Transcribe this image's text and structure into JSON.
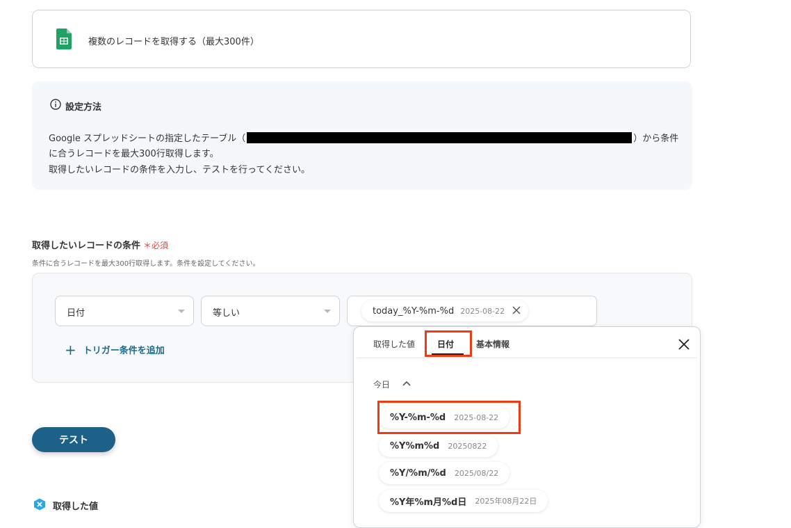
{
  "action": {
    "title": "複数のレコードを取得する（最大300件）",
    "icon": "google-sheets-icon"
  },
  "info": {
    "title": "設定方法",
    "line1_prefix": "Google スプレッドシートの指定したテーブル（",
    "line1_suffix": "）から条件",
    "line2": "に合うレコードを最大300行取得します。",
    "line3": "取得したいレコードの条件を入力し、テストを行ってください。"
  },
  "condition": {
    "label": "取得したいレコードの条件",
    "required": "＊必須",
    "description": "条件に合うレコードを最大300行取得します。条件を設定してください。",
    "field": "日付",
    "operator": "等しい",
    "value_code": "today_%Y-%m-%d",
    "value_sample": "2025-08-22",
    "add_label": "トリガー条件を追加"
  },
  "test_button": "テスト",
  "acquired_title": "取得した値",
  "popup": {
    "tabs": [
      "取得した値",
      "日付",
      "基本情報"
    ],
    "active_tab": "日付",
    "group_label": "今日",
    "options": [
      {
        "code": "%Y-%m-%d",
        "sample": "2025-08-22"
      },
      {
        "code": "%Y%m%d",
        "sample": "20250822"
      },
      {
        "code": "%Y/%m/%d",
        "sample": "2025/08/22"
      },
      {
        "code": "%Y年%m月%d日",
        "sample": "2025年08月22日"
      }
    ]
  },
  "colors": {
    "accent": "#1d6088",
    "highlight": "#ef3b12",
    "required": "#e0463c"
  }
}
